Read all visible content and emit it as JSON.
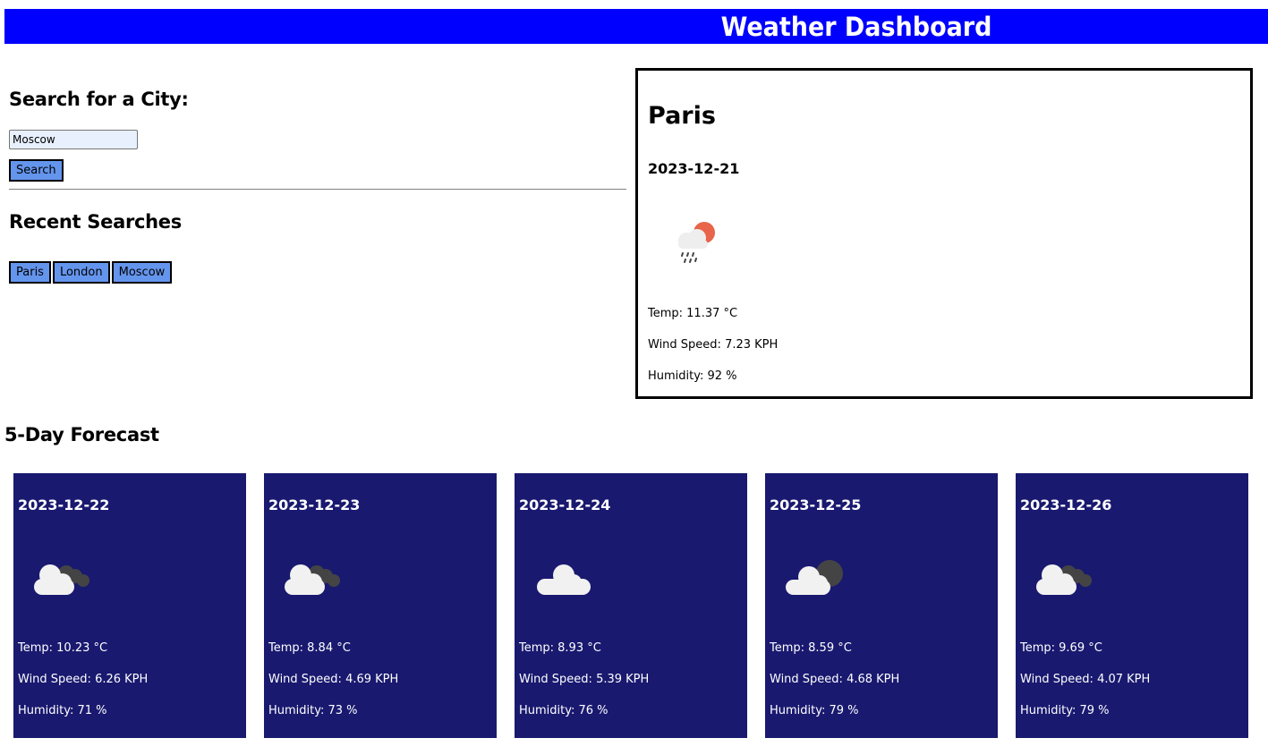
{
  "header": {
    "title": "Weather Dashboard"
  },
  "search": {
    "heading": "Search for a City:",
    "input_value": "Moscow",
    "button_label": "Search"
  },
  "recent": {
    "heading": "Recent Searches",
    "cities": [
      "Paris",
      "London",
      "Moscow"
    ]
  },
  "current": {
    "city": "Paris",
    "date": "2023-12-21",
    "icon": "rain-sun-icon",
    "temp": "Temp: 11.37 °C",
    "wind": "Wind Speed: 7.23 KPH",
    "humidity": "Humidity: 92 %"
  },
  "forecast": {
    "heading": "5-Day Forecast",
    "days": [
      {
        "date": "2023-12-22",
        "icon": "broken-clouds-icon",
        "temp": "Temp: 10.23 °C",
        "wind": "Wind Speed: 6.26 KPH",
        "humidity": "Humidity: 71 %"
      },
      {
        "date": "2023-12-23",
        "icon": "broken-clouds-icon",
        "temp": "Temp: 8.84 °C",
        "wind": "Wind Speed: 4.69 KPH",
        "humidity": "Humidity: 73 %"
      },
      {
        "date": "2023-12-24",
        "icon": "cloud-icon",
        "temp": "Temp: 8.93 °C",
        "wind": "Wind Speed: 5.39 KPH",
        "humidity": "Humidity: 76 %"
      },
      {
        "date": "2023-12-25",
        "icon": "cloud-night-icon",
        "temp": "Temp: 8.59 °C",
        "wind": "Wind Speed: 4.68 KPH",
        "humidity": "Humidity: 79 %"
      },
      {
        "date": "2023-12-26",
        "icon": "broken-clouds-icon",
        "temp": "Temp: 9.69 °C",
        "wind": "Wind Speed: 4.07 KPH",
        "humidity": "Humidity: 79 %"
      }
    ]
  },
  "colors": {
    "header_bg": "#0000ff",
    "button_bg": "#6495ed",
    "card_bg": "#191970"
  }
}
